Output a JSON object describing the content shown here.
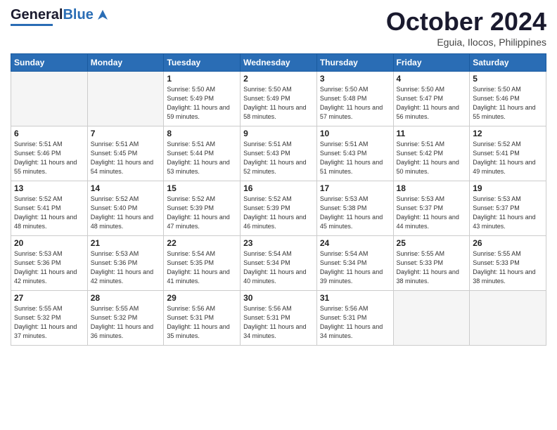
{
  "header": {
    "logo_general": "General",
    "logo_blue": "Blue",
    "month_title": "October 2024",
    "location": "Eguia, Ilocos, Philippines"
  },
  "weekdays": [
    "Sunday",
    "Monday",
    "Tuesday",
    "Wednesday",
    "Thursday",
    "Friday",
    "Saturday"
  ],
  "weeks": [
    [
      {
        "day": "",
        "sunrise": "",
        "sunset": "",
        "daylight": "",
        "empty": true
      },
      {
        "day": "",
        "sunrise": "",
        "sunset": "",
        "daylight": "",
        "empty": true
      },
      {
        "day": "1",
        "sunrise": "Sunrise: 5:50 AM",
        "sunset": "Sunset: 5:49 PM",
        "daylight": "Daylight: 11 hours and 59 minutes.",
        "empty": false
      },
      {
        "day": "2",
        "sunrise": "Sunrise: 5:50 AM",
        "sunset": "Sunset: 5:49 PM",
        "daylight": "Daylight: 11 hours and 58 minutes.",
        "empty": false
      },
      {
        "day": "3",
        "sunrise": "Sunrise: 5:50 AM",
        "sunset": "Sunset: 5:48 PM",
        "daylight": "Daylight: 11 hours and 57 minutes.",
        "empty": false
      },
      {
        "day": "4",
        "sunrise": "Sunrise: 5:50 AM",
        "sunset": "Sunset: 5:47 PM",
        "daylight": "Daylight: 11 hours and 56 minutes.",
        "empty": false
      },
      {
        "day": "5",
        "sunrise": "Sunrise: 5:50 AM",
        "sunset": "Sunset: 5:46 PM",
        "daylight": "Daylight: 11 hours and 55 minutes.",
        "empty": false
      }
    ],
    [
      {
        "day": "6",
        "sunrise": "Sunrise: 5:51 AM",
        "sunset": "Sunset: 5:46 PM",
        "daylight": "Daylight: 11 hours and 55 minutes.",
        "empty": false
      },
      {
        "day": "7",
        "sunrise": "Sunrise: 5:51 AM",
        "sunset": "Sunset: 5:45 PM",
        "daylight": "Daylight: 11 hours and 54 minutes.",
        "empty": false
      },
      {
        "day": "8",
        "sunrise": "Sunrise: 5:51 AM",
        "sunset": "Sunset: 5:44 PM",
        "daylight": "Daylight: 11 hours and 53 minutes.",
        "empty": false
      },
      {
        "day": "9",
        "sunrise": "Sunrise: 5:51 AM",
        "sunset": "Sunset: 5:43 PM",
        "daylight": "Daylight: 11 hours and 52 minutes.",
        "empty": false
      },
      {
        "day": "10",
        "sunrise": "Sunrise: 5:51 AM",
        "sunset": "Sunset: 5:43 PM",
        "daylight": "Daylight: 11 hours and 51 minutes.",
        "empty": false
      },
      {
        "day": "11",
        "sunrise": "Sunrise: 5:51 AM",
        "sunset": "Sunset: 5:42 PM",
        "daylight": "Daylight: 11 hours and 50 minutes.",
        "empty": false
      },
      {
        "day": "12",
        "sunrise": "Sunrise: 5:52 AM",
        "sunset": "Sunset: 5:41 PM",
        "daylight": "Daylight: 11 hours and 49 minutes.",
        "empty": false
      }
    ],
    [
      {
        "day": "13",
        "sunrise": "Sunrise: 5:52 AM",
        "sunset": "Sunset: 5:41 PM",
        "daylight": "Daylight: 11 hours and 48 minutes.",
        "empty": false
      },
      {
        "day": "14",
        "sunrise": "Sunrise: 5:52 AM",
        "sunset": "Sunset: 5:40 PM",
        "daylight": "Daylight: 11 hours and 48 minutes.",
        "empty": false
      },
      {
        "day": "15",
        "sunrise": "Sunrise: 5:52 AM",
        "sunset": "Sunset: 5:39 PM",
        "daylight": "Daylight: 11 hours and 47 minutes.",
        "empty": false
      },
      {
        "day": "16",
        "sunrise": "Sunrise: 5:52 AM",
        "sunset": "Sunset: 5:39 PM",
        "daylight": "Daylight: 11 hours and 46 minutes.",
        "empty": false
      },
      {
        "day": "17",
        "sunrise": "Sunrise: 5:53 AM",
        "sunset": "Sunset: 5:38 PM",
        "daylight": "Daylight: 11 hours and 45 minutes.",
        "empty": false
      },
      {
        "day": "18",
        "sunrise": "Sunrise: 5:53 AM",
        "sunset": "Sunset: 5:37 PM",
        "daylight": "Daylight: 11 hours and 44 minutes.",
        "empty": false
      },
      {
        "day": "19",
        "sunrise": "Sunrise: 5:53 AM",
        "sunset": "Sunset: 5:37 PM",
        "daylight": "Daylight: 11 hours and 43 minutes.",
        "empty": false
      }
    ],
    [
      {
        "day": "20",
        "sunrise": "Sunrise: 5:53 AM",
        "sunset": "Sunset: 5:36 PM",
        "daylight": "Daylight: 11 hours and 42 minutes.",
        "empty": false
      },
      {
        "day": "21",
        "sunrise": "Sunrise: 5:53 AM",
        "sunset": "Sunset: 5:36 PM",
        "daylight": "Daylight: 11 hours and 42 minutes.",
        "empty": false
      },
      {
        "day": "22",
        "sunrise": "Sunrise: 5:54 AM",
        "sunset": "Sunset: 5:35 PM",
        "daylight": "Daylight: 11 hours and 41 minutes.",
        "empty": false
      },
      {
        "day": "23",
        "sunrise": "Sunrise: 5:54 AM",
        "sunset": "Sunset: 5:34 PM",
        "daylight": "Daylight: 11 hours and 40 minutes.",
        "empty": false
      },
      {
        "day": "24",
        "sunrise": "Sunrise: 5:54 AM",
        "sunset": "Sunset: 5:34 PM",
        "daylight": "Daylight: 11 hours and 39 minutes.",
        "empty": false
      },
      {
        "day": "25",
        "sunrise": "Sunrise: 5:55 AM",
        "sunset": "Sunset: 5:33 PM",
        "daylight": "Daylight: 11 hours and 38 minutes.",
        "empty": false
      },
      {
        "day": "26",
        "sunrise": "Sunrise: 5:55 AM",
        "sunset": "Sunset: 5:33 PM",
        "daylight": "Daylight: 11 hours and 38 minutes.",
        "empty": false
      }
    ],
    [
      {
        "day": "27",
        "sunrise": "Sunrise: 5:55 AM",
        "sunset": "Sunset: 5:32 PM",
        "daylight": "Daylight: 11 hours and 37 minutes.",
        "empty": false
      },
      {
        "day": "28",
        "sunrise": "Sunrise: 5:55 AM",
        "sunset": "Sunset: 5:32 PM",
        "daylight": "Daylight: 11 hours and 36 minutes.",
        "empty": false
      },
      {
        "day": "29",
        "sunrise": "Sunrise: 5:56 AM",
        "sunset": "Sunset: 5:31 PM",
        "daylight": "Daylight: 11 hours and 35 minutes.",
        "empty": false
      },
      {
        "day": "30",
        "sunrise": "Sunrise: 5:56 AM",
        "sunset": "Sunset: 5:31 PM",
        "daylight": "Daylight: 11 hours and 34 minutes.",
        "empty": false
      },
      {
        "day": "31",
        "sunrise": "Sunrise: 5:56 AM",
        "sunset": "Sunset: 5:31 PM",
        "daylight": "Daylight: 11 hours and 34 minutes.",
        "empty": false
      },
      {
        "day": "",
        "sunrise": "",
        "sunset": "",
        "daylight": "",
        "empty": true
      },
      {
        "day": "",
        "sunrise": "",
        "sunset": "",
        "daylight": "",
        "empty": true
      }
    ]
  ]
}
